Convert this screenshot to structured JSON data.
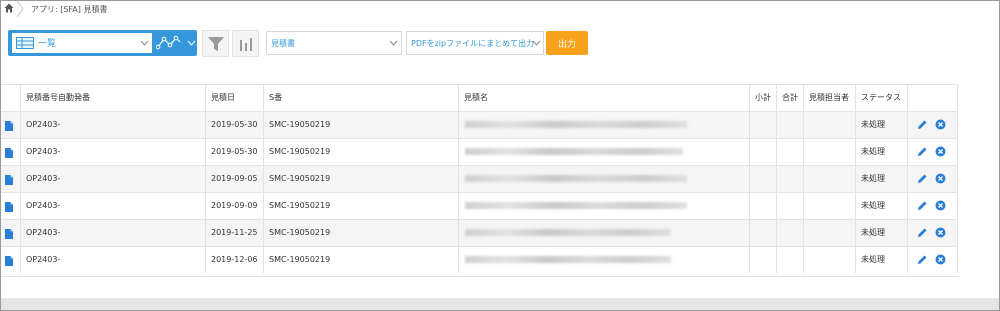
{
  "breadcrumb": {
    "text": "アプリ: [SFA] 見積書"
  },
  "toolbar": {
    "view_label": "一覧",
    "select1_value": "見積書",
    "select2_value": "PDFをzipファイルにまとめて出力",
    "output_label": "出力"
  },
  "colors": {
    "accent": "#3498db",
    "output": "#f7a21b"
  },
  "table": {
    "headers": [
      "見積番号自動発番",
      "見積日",
      "S番",
      "見積名",
      "小計",
      "合計",
      "見積担当者",
      "ステータス"
    ],
    "rows": [
      {
        "no": "OP2403-",
        "date": "2019-05-30",
        "s": "SMC-19050219",
        "status": "未処理"
      },
      {
        "no": "OP2403-",
        "date": "2019-05-30",
        "s": "SMC-19050219",
        "status": "未処理"
      },
      {
        "no": "OP2403-",
        "date": "2019-09-05",
        "s": "SMC-19050219",
        "status": "未処理"
      },
      {
        "no": "OP2403-",
        "date": "2019-09-09",
        "s": "SMC-19050219",
        "status": "未処理"
      },
      {
        "no": "OP2403-",
        "date": "2019-11-25",
        "s": "SMC-19050219",
        "status": "未処理"
      },
      {
        "no": "OP2403-",
        "date": "2019-12-06",
        "s": "SMC-19050219",
        "status": "未処理"
      }
    ]
  }
}
